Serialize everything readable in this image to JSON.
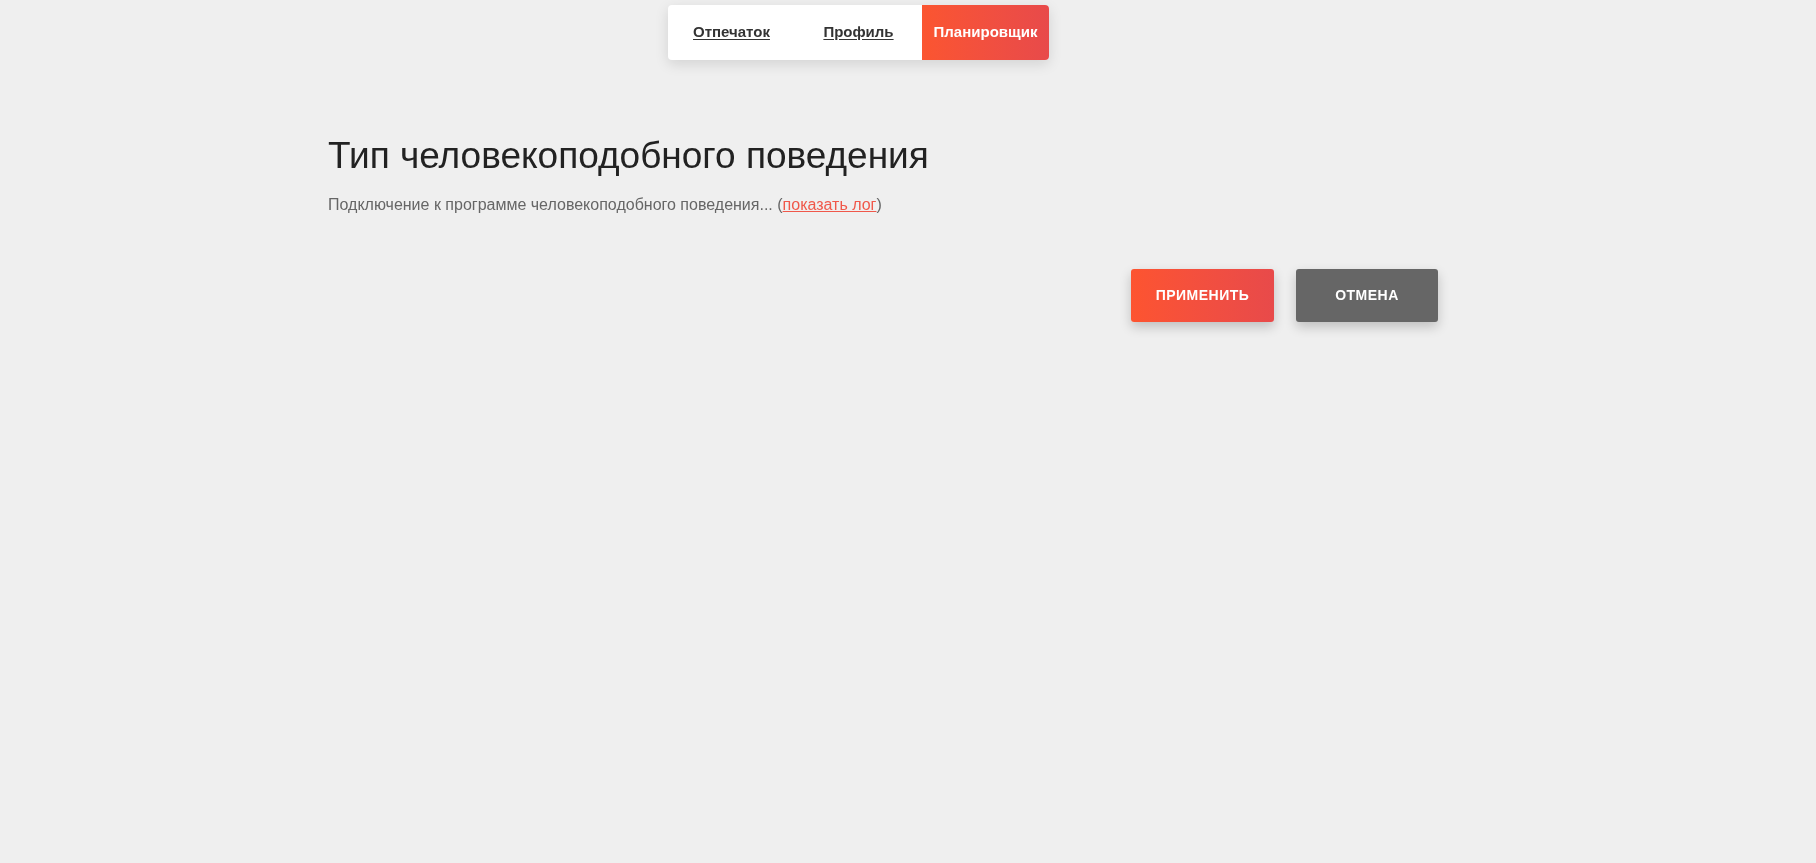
{
  "tabs": [
    {
      "label": "Отпечаток",
      "selected": false
    },
    {
      "label": "Профиль",
      "selected": false
    },
    {
      "label": "Планировщик",
      "selected": true
    }
  ],
  "section": {
    "title": "Тип человекоподобного поведения",
    "status_text": "Подключение к программе человекоподобного поведения... (",
    "log_link": "показать лог",
    "status_end": ")"
  },
  "buttons": [
    {
      "label": "ПРИМЕНИТЬ",
      "kind": "primary"
    },
    {
      "label": "ОТМЕНА",
      "kind": "secondary"
    }
  ]
}
